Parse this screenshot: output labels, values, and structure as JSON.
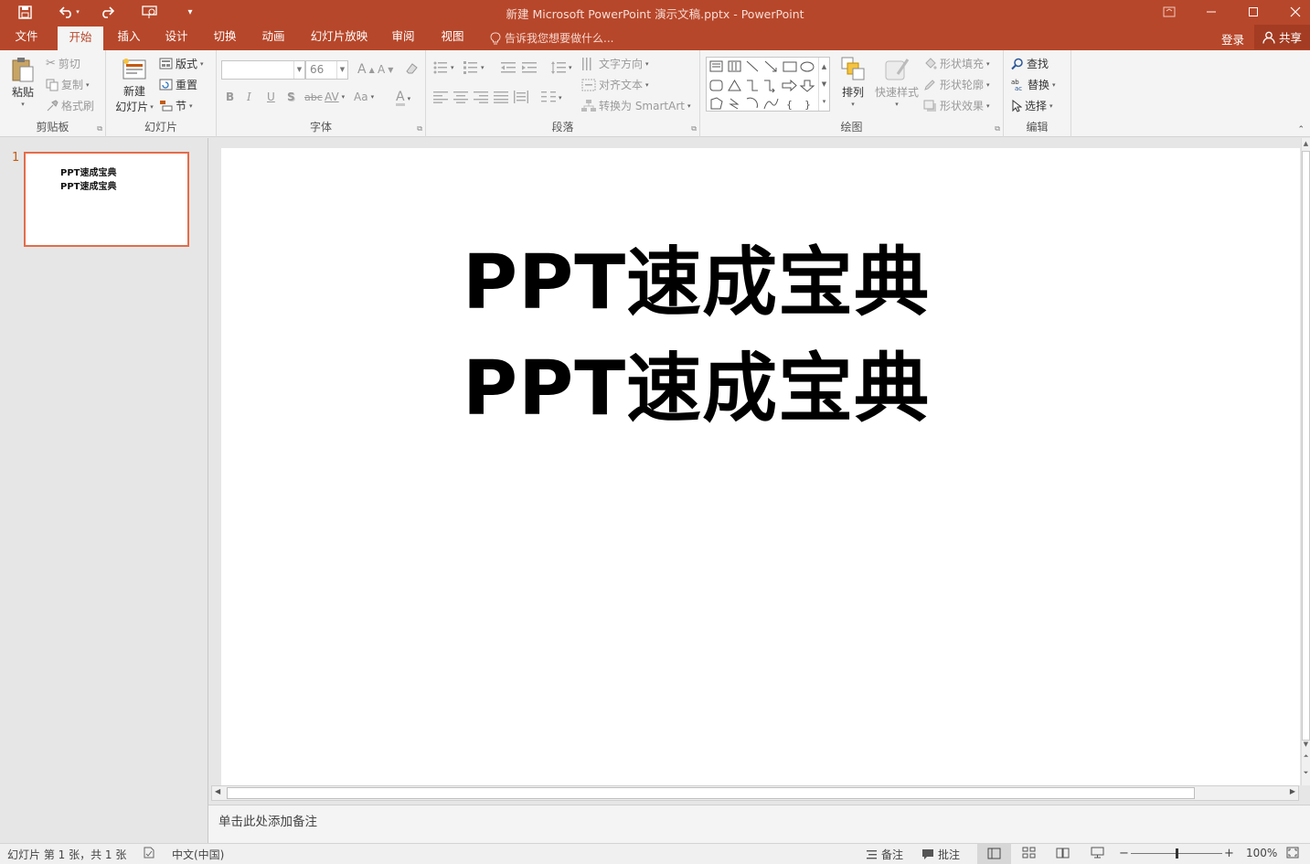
{
  "app": {
    "title": "新建 Microsoft PowerPoint 演示文稿.pptx - PowerPoint",
    "accent": "#b7472a"
  },
  "qat": {
    "save_icon": "save-icon",
    "undo_icon": "undo-icon",
    "redo_icon": "redo-icon",
    "present_icon": "start-from-beginning-icon",
    "customize": "▾"
  },
  "tabs": [
    {
      "label": "文件",
      "active": false
    },
    {
      "label": "开始",
      "active": true
    },
    {
      "label": "插入",
      "active": false
    },
    {
      "label": "设计",
      "active": false
    },
    {
      "label": "切换",
      "active": false
    },
    {
      "label": "动画",
      "active": false
    },
    {
      "label": "幻灯片放映",
      "active": false
    },
    {
      "label": "审阅",
      "active": false
    },
    {
      "label": "视图",
      "active": false
    }
  ],
  "tellme": "告诉我您想要做什么...",
  "account": {
    "login": "登录",
    "share": "共享"
  },
  "ribbon": {
    "clipboard": {
      "label": "剪贴板",
      "paste": "粘贴",
      "cut": "剪切",
      "copy": "复制",
      "format_painter": "格式刷"
    },
    "slides": {
      "label": "幻灯片",
      "new_slide_1": "新建",
      "new_slide_2": "幻灯片",
      "layout": "版式",
      "reset": "重置",
      "section": "节"
    },
    "font": {
      "label": "字体",
      "font_name": "",
      "font_size": "66",
      "bold": "B",
      "italic": "I",
      "underline": "U",
      "shadow": "S",
      "strike": "abc",
      "spacing": "AV",
      "case": "Aa",
      "grow": "A",
      "shrink": "A",
      "clear": "A",
      "color": "A"
    },
    "paragraph": {
      "label": "段落",
      "text_direction": "文字方向",
      "align_text": "对齐文本",
      "smartart": "转换为 SmartArt"
    },
    "drawing": {
      "label": "绘图",
      "arrange": "排列",
      "quick_styles": "快速样式",
      "fill": "形状填充",
      "outline": "形状轮廓",
      "effects": "形状效果"
    },
    "editing": {
      "label": "编辑",
      "find": "查找",
      "replace": "替换",
      "select": "选择"
    }
  },
  "thumbnails": [
    {
      "number": "1",
      "line1": "PPT速成宝典",
      "line2": "PPT速成宝典"
    }
  ],
  "slide": {
    "line1": "PPT速成宝典",
    "line2": "PPT速成宝典"
  },
  "notes_placeholder": "单击此处添加备注",
  "statusbar": {
    "slide_info": "幻灯片 第 1 张，共 1 张",
    "language": "中文(中国)",
    "notes": "备注",
    "comments": "批注",
    "zoom": "100%",
    "zoom_fraction": 0.5
  }
}
